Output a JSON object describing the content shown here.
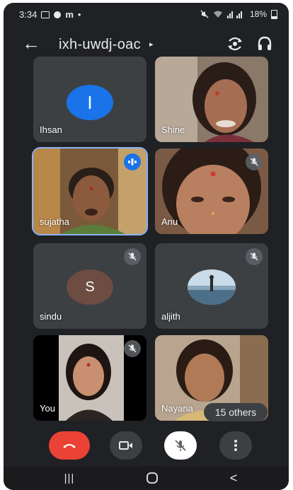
{
  "status_bar": {
    "time": "3:34",
    "left_icons": [
      "gallery-icon",
      "record-icon"
    ],
    "carrier_mark": "m",
    "dot": "•",
    "battery": "18%"
  },
  "header": {
    "meeting_code": "ixh-uwdj-oac",
    "expand_glyph": "▸",
    "back_glyph": "←"
  },
  "participants": [
    {
      "name": "Ihsan",
      "type": "letter",
      "letter": "I",
      "avatar_color": "#1a73e8"
    },
    {
      "name": "Shine",
      "type": "video"
    },
    {
      "name": "sujatha",
      "type": "video",
      "speaking": true
    },
    {
      "name": "Anu",
      "type": "video",
      "muted": true
    },
    {
      "name": "sindu",
      "type": "letter",
      "letter": "S",
      "avatar_color": "#6d4c41",
      "muted": true
    },
    {
      "name": "aljith",
      "type": "photo",
      "muted": true
    },
    {
      "name": "You",
      "type": "video",
      "muted": true
    },
    {
      "name": "Nayana",
      "type": "video"
    }
  ],
  "others_label": "15 others",
  "controls": {
    "end_call_color": "#ea4335",
    "icons": [
      "end-call-icon",
      "camera-icon",
      "mic-off-icon",
      "more-icon"
    ]
  },
  "navbar": {
    "recents_glyph": "|||",
    "back_glyph": "<"
  }
}
